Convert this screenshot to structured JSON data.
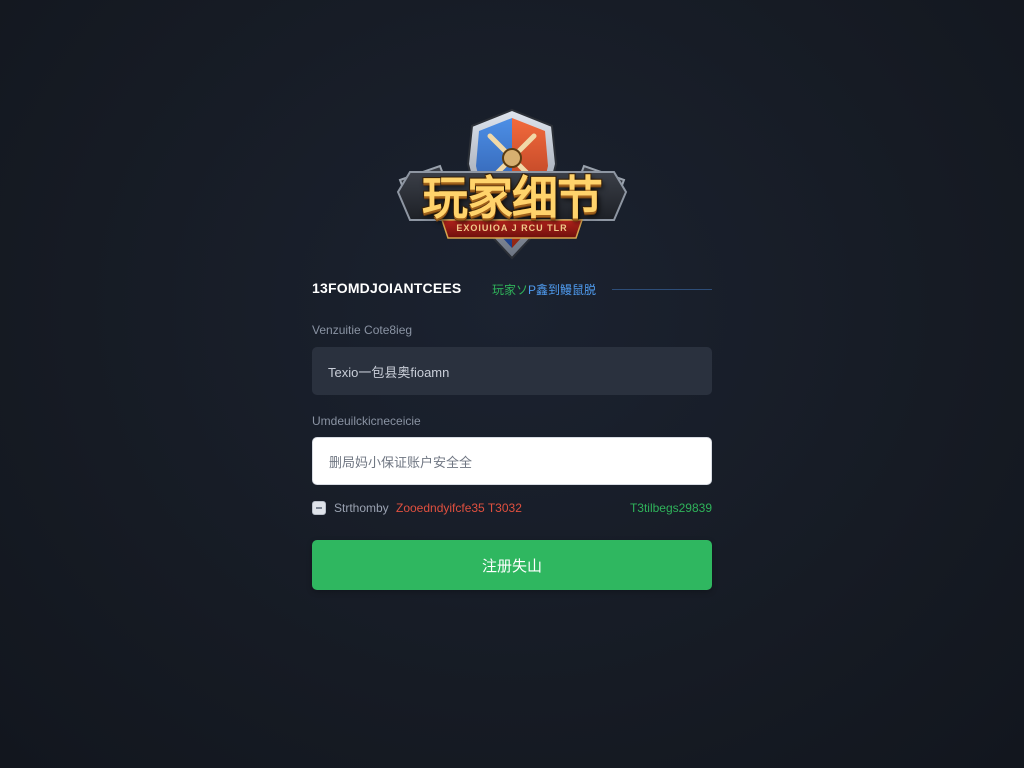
{
  "logo": {
    "title": "玩家细节",
    "ribbon_text": "EXOIUIOA J RCU TLR"
  },
  "tabs": {
    "primary_label": "13FOMDJOIANTCEES",
    "secondary_label_green": "玩家ソ",
    "secondary_label_blue": "P鑫到鳗鼠脱"
  },
  "form": {
    "field1_label": "Venzuitie Cote8ieg",
    "field1_value": "Texio一包县奥fioamn",
    "field2_label": "Umdeuilckicneceicie",
    "field2_placeholder": "删局妈小保证账户安全全"
  },
  "options": {
    "checkbox_label": "Strthomby",
    "warning_text": "Zooedndyifcfe35 T3032",
    "link_text": "T3tilbegs29839"
  },
  "submit": {
    "label": "注册失山"
  },
  "colors": {
    "background": "#161b24",
    "accent_green": "#2fb760",
    "accent_blue": "#4f9cf0",
    "warning_red": "#e0503f",
    "logo_gold": "#ffd36b"
  }
}
